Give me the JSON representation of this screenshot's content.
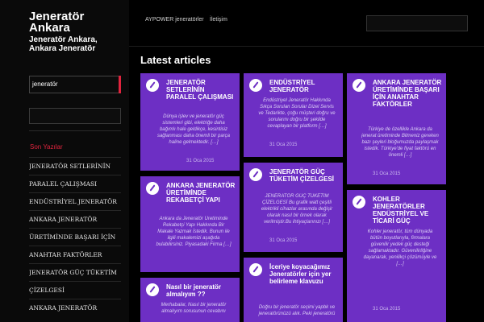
{
  "site": {
    "title": "Jeneratör Ankara",
    "description": "Jeneratör Ankara, Ankara Jeneratör"
  },
  "nav": {
    "items": [
      "AYPOWER jeneratörler",
      "İletişim"
    ]
  },
  "sidebar": {
    "category_label": "jeneratör",
    "search_placeholder": "",
    "recent_heading": "Son Yazılar",
    "recent_posts": [
      "JENERATÖR SETLERİNİN",
      "PARALEL ÇALIŞMASI",
      "ENDÜSTRİYEL JENERATÖR",
      "ANKARA JENERATÖR",
      "ÜRETİMİNDE BAŞARI İÇİN",
      "ANAHTAR FAKTÖRLER",
      "JENERATÖR GÜÇ TÜKETİM",
      "ÇİZELGESİ",
      "ANKARA JENERATÖR"
    ]
  },
  "header": {
    "search_placeholder": ""
  },
  "main": {
    "section_title": "Latest articles",
    "articles": [
      {
        "title": "JENERATÖR SETLERİNİN PARALEL ÇALIŞMASI",
        "excerpt": "Dünya işlev ve jeneratör güç sistemleri gibi, elektriğe daha bağımlı hale geldikçe, kesintisiz sağlanması daha önemli bir parça haline gelmektedir. […]",
        "date": "31 Oca 2015"
      },
      {
        "title": "ENDÜSTRİYEL JENERATÖR",
        "excerpt": "Endüstriyel Jeneratör Hakkında Sıkça Sorulan Sorular Dizel Servis ve Tedarikte, çoğu müşteri doğru ve sorularını doğru bir şekilde cevaplayan bir platform […]",
        "date": "31 Oca 2015"
      },
      {
        "title": "ANKARA JENERATÖR ÜRETİMİNDE BAŞARI İÇİN ANAHTAR FAKTÖRLER",
        "excerpt": "Türkiye de özellikle Ankara da jenerat üretiminde Bilmeniz gereken bazı şeyleri bloğumuzda paylaşmak istedik. Türkiye'de fiyat faktörü en önemli […]",
        "date": "31 Oca 2015"
      },
      {
        "title": "JENERATÖR GÜÇ TÜKETİM ÇİZELGESİ",
        "excerpt": "JENERATÖR GÜÇ TÜKETİM ÇİZELGESİ Bu grafik watt çeşitli elektrikli cihazlar arasında değişir olarak nasıl bir örnek olarak verilmiştir.Bu ihtiyaçlarınızı […]",
        "date": "31 Oca 2015"
      },
      {
        "title": "ANKARA JENERATÖR ÜRETİMİNDE REKABETÇİ YAPI",
        "excerpt": "Ankara da Jeneratör Üretiminde Rekabetçi Yapı Hakkında Bir Makale Yazmak İstedik. Bunun ile ilgili makalemizi aşağıda bulabilirsiniz. Piyasadaki Firma […]",
        "date": "31 Oca 2015"
      },
      {
        "title": "KOHLER JENERATÖRLER ENDÜSTRİYEL VE TİCARİ GÜÇ",
        "excerpt": "Kohler jeneratör, tüm dünyada bütün boyutlarıyla, firmalara güvenilir yedek güç desteği sağlamaktadır. Güvenilirliğine dayanarak, yenilikçi çözümüyle ve […]",
        "date": "31 Oca 2015"
      },
      {
        "title": "Nasıl bir jeneratör almalıyım ??",
        "excerpt": "Merhabalar, Nasıl bir jeneratör almalıyım sorusunun cevabını",
        "date": ""
      },
      {
        "title": "İceriye koyacağımız Jeneratörler için yer belirleme klavuzu",
        "excerpt": "Doğru bir jeneratör seçimi yapbk ve jeneratörünüzü alık. Peki jeneratörü",
        "date": ""
      }
    ]
  },
  "colors": {
    "card_bg": "#6d2fc4",
    "accent": "#e0243e",
    "background": "#000000"
  }
}
